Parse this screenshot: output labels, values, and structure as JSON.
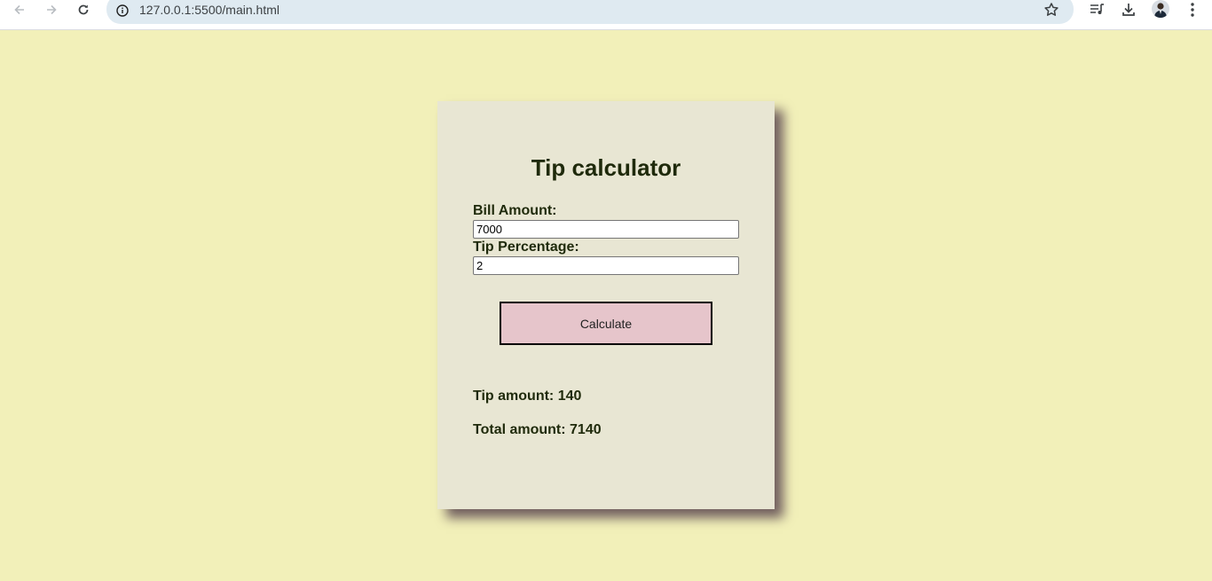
{
  "browser": {
    "url": "127.0.0.1:5500/main.html"
  },
  "app": {
    "title": "Tip calculator",
    "bill_label": "Bill Amount:",
    "bill_value": "7000",
    "tip_label": "Tip Percentage:",
    "tip_value": "2",
    "button_label": "Calculate",
    "tip_amount_text": "Tip amount: 140",
    "total_amount_text": "Total amount: 7140"
  },
  "colors": {
    "page_background": "#f2f0b9",
    "card_background": "#e8e6d3",
    "card_shadow": "#72605f",
    "button_background": "#e6c5cb",
    "text": "#1f2a0b"
  },
  "icons": [
    "back-arrow-icon",
    "forward-arrow-icon",
    "reload-icon",
    "site-info-icon",
    "bookmark-star-icon",
    "reading-list-icon",
    "download-icon",
    "profile-avatar-icon",
    "more-menu-icon"
  ]
}
